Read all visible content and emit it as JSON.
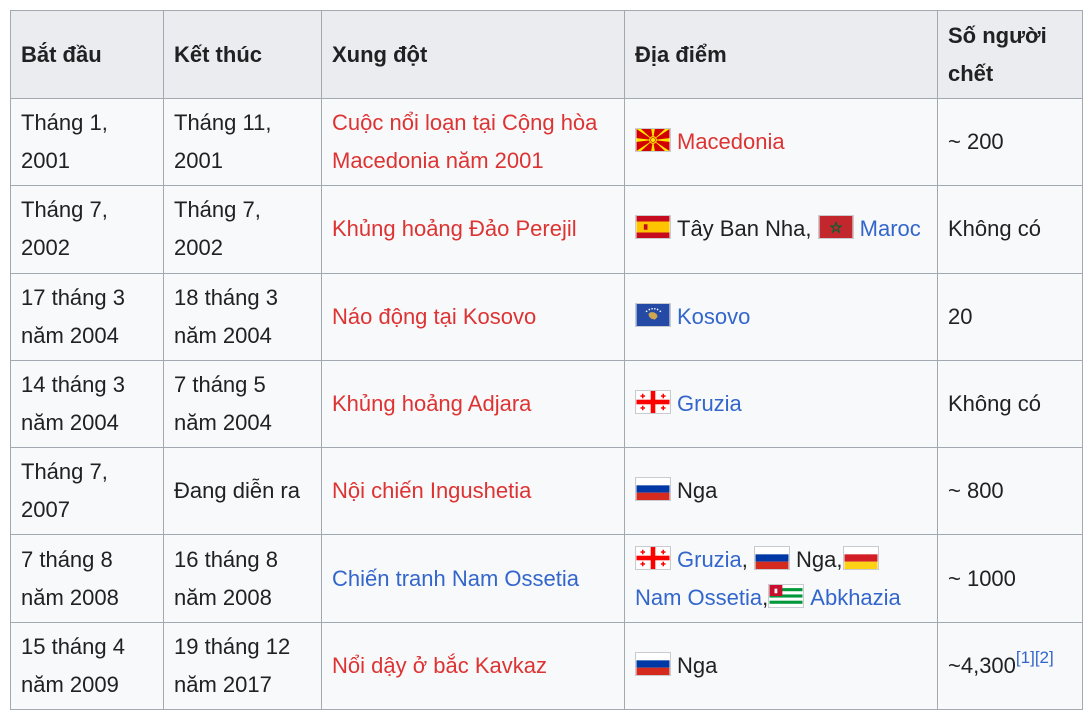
{
  "headers": {
    "start": "Bắt đầu",
    "end": "Kết thúc",
    "conflict": "Xung đột",
    "location": "Địa điểm",
    "deaths": "Số người chết"
  },
  "rows": [
    {
      "start": "Tháng 1, 2001",
      "end": "Tháng 11, 2001",
      "conflict": "Cuộc nổi loạn tại Cộng hòa Macedonia năm 2001",
      "conflict_link": "red",
      "location": [
        {
          "flag": "macedonia-flag-icon",
          "name": "Macedonia",
          "link": "red"
        }
      ],
      "deaths": "~ 200"
    },
    {
      "start": "Tháng 7, 2002",
      "end": "Tháng 7, 2002",
      "conflict": "Khủng hoảng Đảo Perejil",
      "conflict_link": "red",
      "location": [
        {
          "flag": "spain-flag-icon",
          "name": "Tây Ban Nha",
          "link": "none",
          "sep": ", "
        },
        {
          "flag": "morocco-flag-icon",
          "name": "Maroc",
          "link": "blue"
        }
      ],
      "deaths": "Không có"
    },
    {
      "start": "17 tháng 3 năm 2004",
      "end": "18 tháng 3 năm 2004",
      "conflict": "Náo động tại Kosovo",
      "conflict_link": "red",
      "location": [
        {
          "flag": "kosovo-flag-icon",
          "name": "Kosovo",
          "link": "blue"
        }
      ],
      "deaths": "20"
    },
    {
      "start": "14 tháng 3 năm 2004",
      "end": "7 tháng 5 năm 2004",
      "conflict": "Khủng hoảng Adjara",
      "conflict_link": "red",
      "location": [
        {
          "flag": "georgia-flag-icon",
          "name": "Gruzia",
          "link": "blue"
        }
      ],
      "deaths": "Không có"
    },
    {
      "start": "Tháng 7, 2007",
      "end": "Đang diễn ra",
      "conflict": "Nội chiến Ingushetia",
      "conflict_link": "red",
      "location": [
        {
          "flag": "russia-flag-icon",
          "name": "Nga",
          "link": "none"
        }
      ],
      "deaths": "~ 800"
    },
    {
      "start": "7 tháng 8 năm 2008",
      "end": "16 tháng 8 năm 2008",
      "conflict": "Chiến tranh Nam Ossetia",
      "conflict_link": "blue",
      "location": [
        {
          "flag": "georgia-flag-icon",
          "name": "Gruzia",
          "link": "blue",
          "sep": ", "
        },
        {
          "flag": "russia-flag-icon",
          "name": "Nga",
          "link": "none",
          "sep": ","
        },
        {
          "flag": "south-ossetia-flag-icon",
          "name": "Nam Ossetia",
          "link": "blue",
          "sep": ","
        },
        {
          "flag": "abkhazia-flag-icon",
          "name": "Abkhazia",
          "link": "blue"
        }
      ],
      "deaths": "~ 1000"
    },
    {
      "start": "15 tháng 4 năm 2009",
      "end": "19 tháng 12 năm 2017",
      "conflict": "Nổi dậy ở bắc Kavkaz",
      "conflict_link": "red",
      "location": [
        {
          "flag": "russia-flag-icon",
          "name": "Nga",
          "link": "none"
        }
      ],
      "deaths": "~4,300",
      "refs": [
        "[1]",
        "[2]"
      ]
    }
  ],
  "colors": {
    "red_link": "#dd3333",
    "blue_link": "#3366cc",
    "header_bg": "#eaecf0",
    "cell_bg": "#f8f9fa",
    "border": "#a2a9b1"
  }
}
